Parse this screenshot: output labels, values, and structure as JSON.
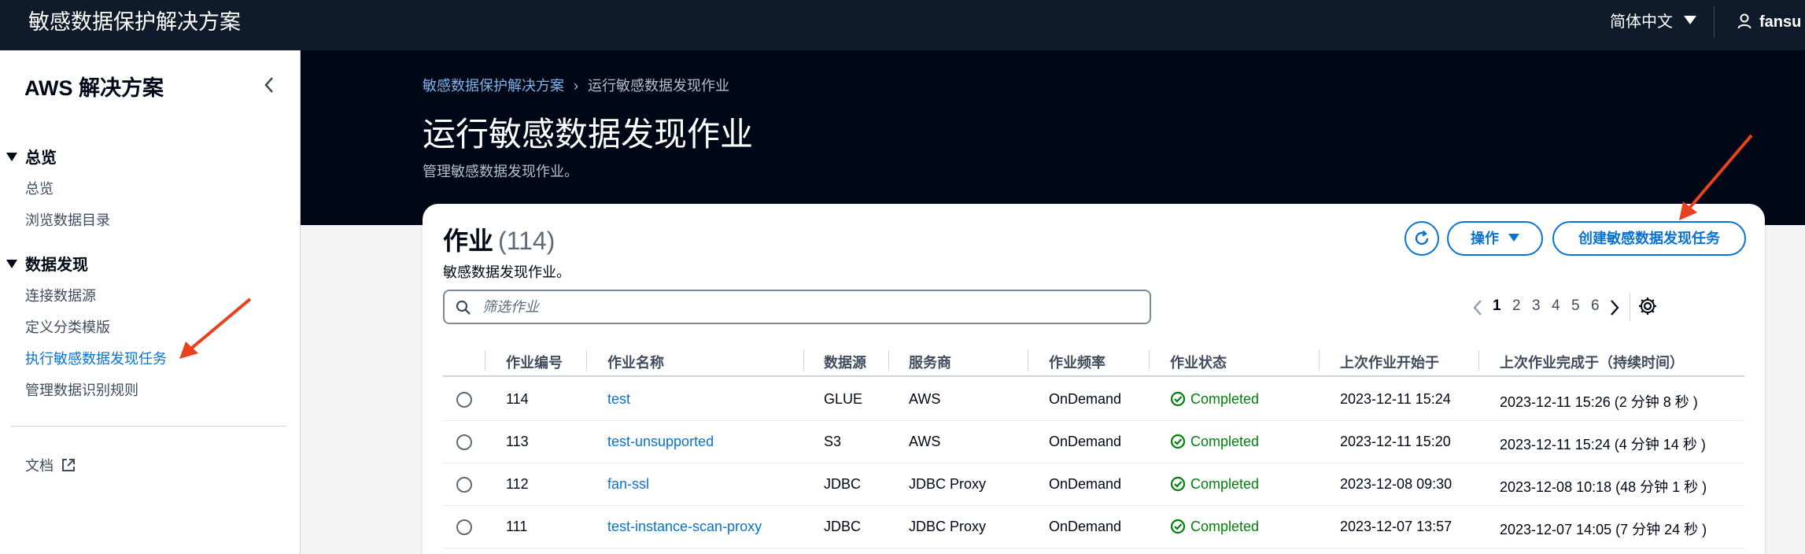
{
  "topbar": {
    "brand": "敏感数据保护解决方案",
    "language": "简体中文",
    "user": "fansu"
  },
  "sidebar": {
    "title": "AWS 解决方案",
    "sections": [
      {
        "label": "总览",
        "items": [
          "总览",
          "浏览数据目录"
        ]
      },
      {
        "label": "数据发现",
        "items": [
          "连接数据源",
          "定义分类模版",
          "执行敏感数据发现任务",
          "管理数据识别规则"
        ]
      }
    ],
    "active_item": "执行敏感数据发现任务",
    "docs_label": "文档"
  },
  "header": {
    "breadcrumbs": [
      "敏感数据保护解决方案",
      "运行敏感数据发现作业"
    ],
    "title": "运行敏感数据发现作业",
    "description": "管理敏感数据发现作业。"
  },
  "jobs": {
    "title": "作业",
    "count": "(114)",
    "description": "敏感数据发现作业。",
    "actions_label": "操作",
    "create_label": "创建敏感数据发现任务",
    "search_placeholder": "筛选作业",
    "pagination": {
      "current": "1",
      "pages": [
        "2",
        "3",
        "4",
        "5",
        "6"
      ]
    },
    "columns": [
      "作业编号",
      "作业名称",
      "数据源",
      "服务商",
      "作业频率",
      "作业状态",
      "上次作业开始于",
      "上次作业完成于（持续时间）"
    ],
    "rows": [
      {
        "id": "114",
        "name": "test",
        "source": "GLUE",
        "provider": "AWS",
        "frequency": "OnDemand",
        "status": "Completed",
        "started": "2023-12-11 15:24",
        "finished": "2023-12-11 15:26 (2 分钟 8 秒 )"
      },
      {
        "id": "113",
        "name": "test-unsupported",
        "source": "S3",
        "provider": "AWS",
        "frequency": "OnDemand",
        "status": "Completed",
        "started": "2023-12-11 15:20",
        "finished": "2023-12-11 15:24 (4 分钟 14 秒 )"
      },
      {
        "id": "112",
        "name": "fan-ssl",
        "source": "JDBC",
        "provider": "JDBC Proxy",
        "frequency": "OnDemand",
        "status": "Completed",
        "started": "2023-12-08 09:30",
        "finished": "2023-12-08 10:18 (48 分钟 1 秒 )"
      },
      {
        "id": "111",
        "name": "test-instance-scan-proxy",
        "source": "JDBC",
        "provider": "JDBC Proxy",
        "frequency": "OnDemand",
        "status": "Completed",
        "started": "2023-12-07 13:57",
        "finished": "2023-12-07 14:05 (7 分钟 24 秒 )"
      }
    ]
  },
  "colors": {
    "topbar_bg": "#0f1b2a",
    "hero_bg": "#000716",
    "link": "#0972d3",
    "success": "#037f0c",
    "annotation_arrow": "#e8421e"
  }
}
